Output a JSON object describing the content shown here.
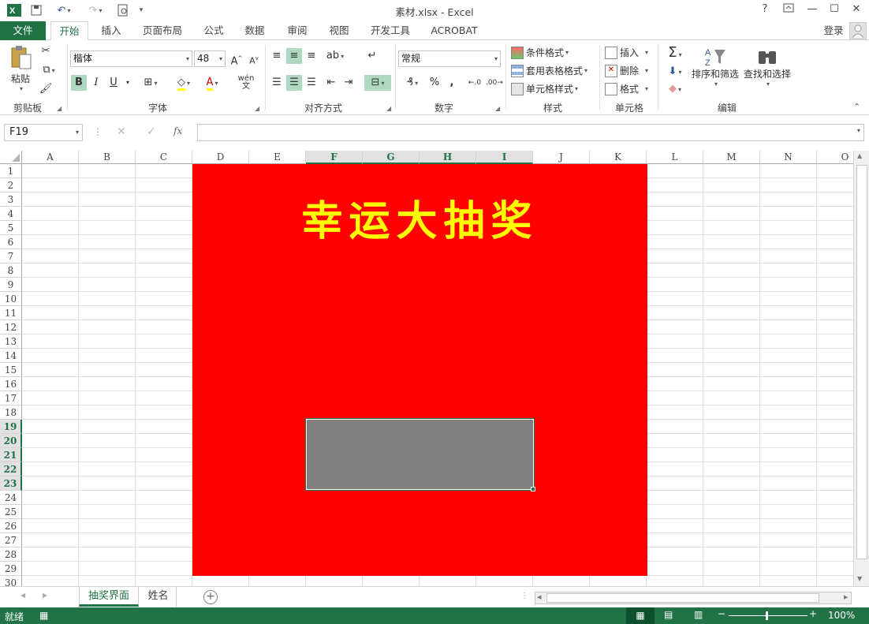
{
  "window": {
    "title": "素材.xlsx - Excel",
    "help": "?",
    "login": "登录"
  },
  "tabs": [
    "文件",
    "开始",
    "插入",
    "页面布局",
    "公式",
    "数据",
    "审阅",
    "视图",
    "开发工具",
    "ACROBAT"
  ],
  "ribbon": {
    "clipboard": {
      "paste": "粘贴",
      "label": "剪贴板"
    },
    "font": {
      "name": "楷体",
      "size": "48",
      "label": "字体",
      "bold": "B",
      "italic": "I",
      "underline": "U",
      "grow": "A",
      "shrink": "A",
      "color_a": "A",
      "wen": "wén"
    },
    "align": {
      "label": "对齐方式"
    },
    "number": {
      "format": "常规",
      "label": "数字",
      "percent": "%",
      "comma": ","
    },
    "styles": {
      "cond": "条件格式",
      "table": "套用表格格式",
      "cell": "单元格样式",
      "label": "样式"
    },
    "cells": {
      "insert": "插入",
      "delete": "删除",
      "format": "格式",
      "label": "单元格"
    },
    "editing": {
      "sort": "排序和筛选",
      "find": "查找和选择",
      "label": "编辑"
    }
  },
  "formula_bar": {
    "name_box": "F19",
    "fx": "fx",
    "value": ""
  },
  "columns": [
    "A",
    "B",
    "C",
    "D",
    "E",
    "F",
    "G",
    "H",
    "I",
    "J",
    "K",
    "L",
    "M",
    "N",
    "O"
  ],
  "selected_columns": [
    "F",
    "G",
    "H",
    "I"
  ],
  "rows": [
    "1",
    "2",
    "3",
    "4",
    "5",
    "6",
    "7",
    "8",
    "9",
    "10",
    "11",
    "12",
    "13",
    "14",
    "15",
    "16",
    "17",
    "18",
    "19",
    "20",
    "21",
    "22",
    "23",
    "24",
    "25",
    "26",
    "27",
    "28",
    "29",
    "30"
  ],
  "selected_rows": [
    "19",
    "20",
    "21",
    "22",
    "23"
  ],
  "sheet": {
    "banner": "幸运大抽奖",
    "panel_color": "#ff0000",
    "banner_color": "#ffff00",
    "box_color": "#808080"
  },
  "sheet_tabs": [
    "抽奖界面",
    "姓名"
  ],
  "status": {
    "ready": "就绪",
    "zoom": "100%"
  }
}
